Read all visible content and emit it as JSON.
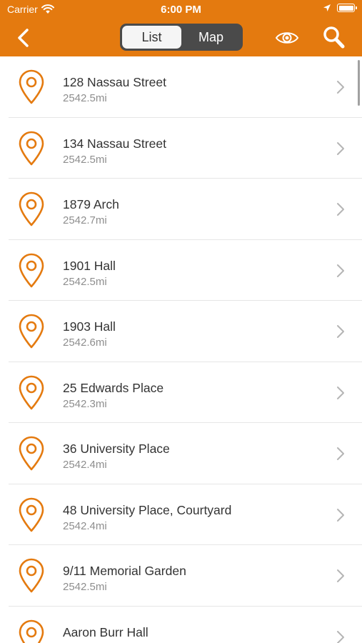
{
  "status_bar": {
    "carrier": "Carrier",
    "time": "6:00 PM"
  },
  "nav_bar": {
    "segments": [
      {
        "label": "List",
        "selected": true
      },
      {
        "label": "Map",
        "selected": false
      }
    ],
    "icons": {
      "back": "back-chevron-icon",
      "eye": "eye-icon",
      "search": "search-icon"
    }
  },
  "colors": {
    "accent": "#E47A0F",
    "segment_bg": "#4a4a4a",
    "title_text": "#333333",
    "subtitle_text": "#8e8e8e"
  },
  "locations": [
    {
      "name": "128 Nassau Street",
      "distance": "2542.5mi"
    },
    {
      "name": "134 Nassau Street",
      "distance": "2542.5mi"
    },
    {
      "name": "1879 Arch",
      "distance": "2542.7mi"
    },
    {
      "name": "1901 Hall",
      "distance": "2542.5mi"
    },
    {
      "name": "1903 Hall",
      "distance": "2542.6mi"
    },
    {
      "name": "25 Edwards Place",
      "distance": "2542.3mi"
    },
    {
      "name": "36 University Place",
      "distance": "2542.4mi"
    },
    {
      "name": "48 University Place, Courtyard",
      "distance": "2542.4mi"
    },
    {
      "name": "9/11 Memorial Garden",
      "distance": "2542.5mi"
    },
    {
      "name": "Aaron Burr Hall",
      "distance": ""
    }
  ]
}
